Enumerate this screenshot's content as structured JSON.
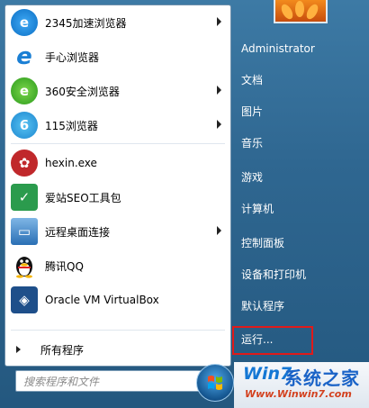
{
  "left_menu": {
    "items": [
      {
        "label": "2345加速浏览器",
        "icon": "2345-browser-icon",
        "has_submenu": true
      },
      {
        "label": "手心浏览器",
        "icon": "shouxin-browser-icon",
        "has_submenu": false
      },
      {
        "label": "360安全浏览器",
        "icon": "360-browser-icon",
        "has_submenu": true
      },
      {
        "label": "115浏览器",
        "icon": "115-browser-icon",
        "has_submenu": true
      },
      {
        "label": "hexin.exe",
        "icon": "hexin-icon",
        "has_submenu": false
      },
      {
        "label": "爱站SEO工具包",
        "icon": "aizhan-seo-icon",
        "has_submenu": false
      },
      {
        "label": "远程桌面连接",
        "icon": "remote-desktop-icon",
        "has_submenu": true
      },
      {
        "label": "腾讯QQ",
        "icon": "qq-penguin-icon",
        "has_submenu": false
      },
      {
        "label": "Oracle VM VirtualBox",
        "icon": "virtualbox-icon",
        "has_submenu": false
      }
    ],
    "all_programs": "所有程序",
    "search_placeholder": "搜索程序和文件"
  },
  "right_menu": {
    "items": [
      "Administrator",
      "文档",
      "图片",
      "音乐",
      "游戏",
      "计算机",
      "控制面板",
      "设备和打印机",
      "默认程序",
      "运行..."
    ]
  },
  "watermark": {
    "logo": "Win7",
    "title": "系统之家",
    "url": "Www.Winwin7.com"
  },
  "colors": {
    "menu_blue": "#2f6791",
    "highlight_red": "#e01a1a"
  }
}
